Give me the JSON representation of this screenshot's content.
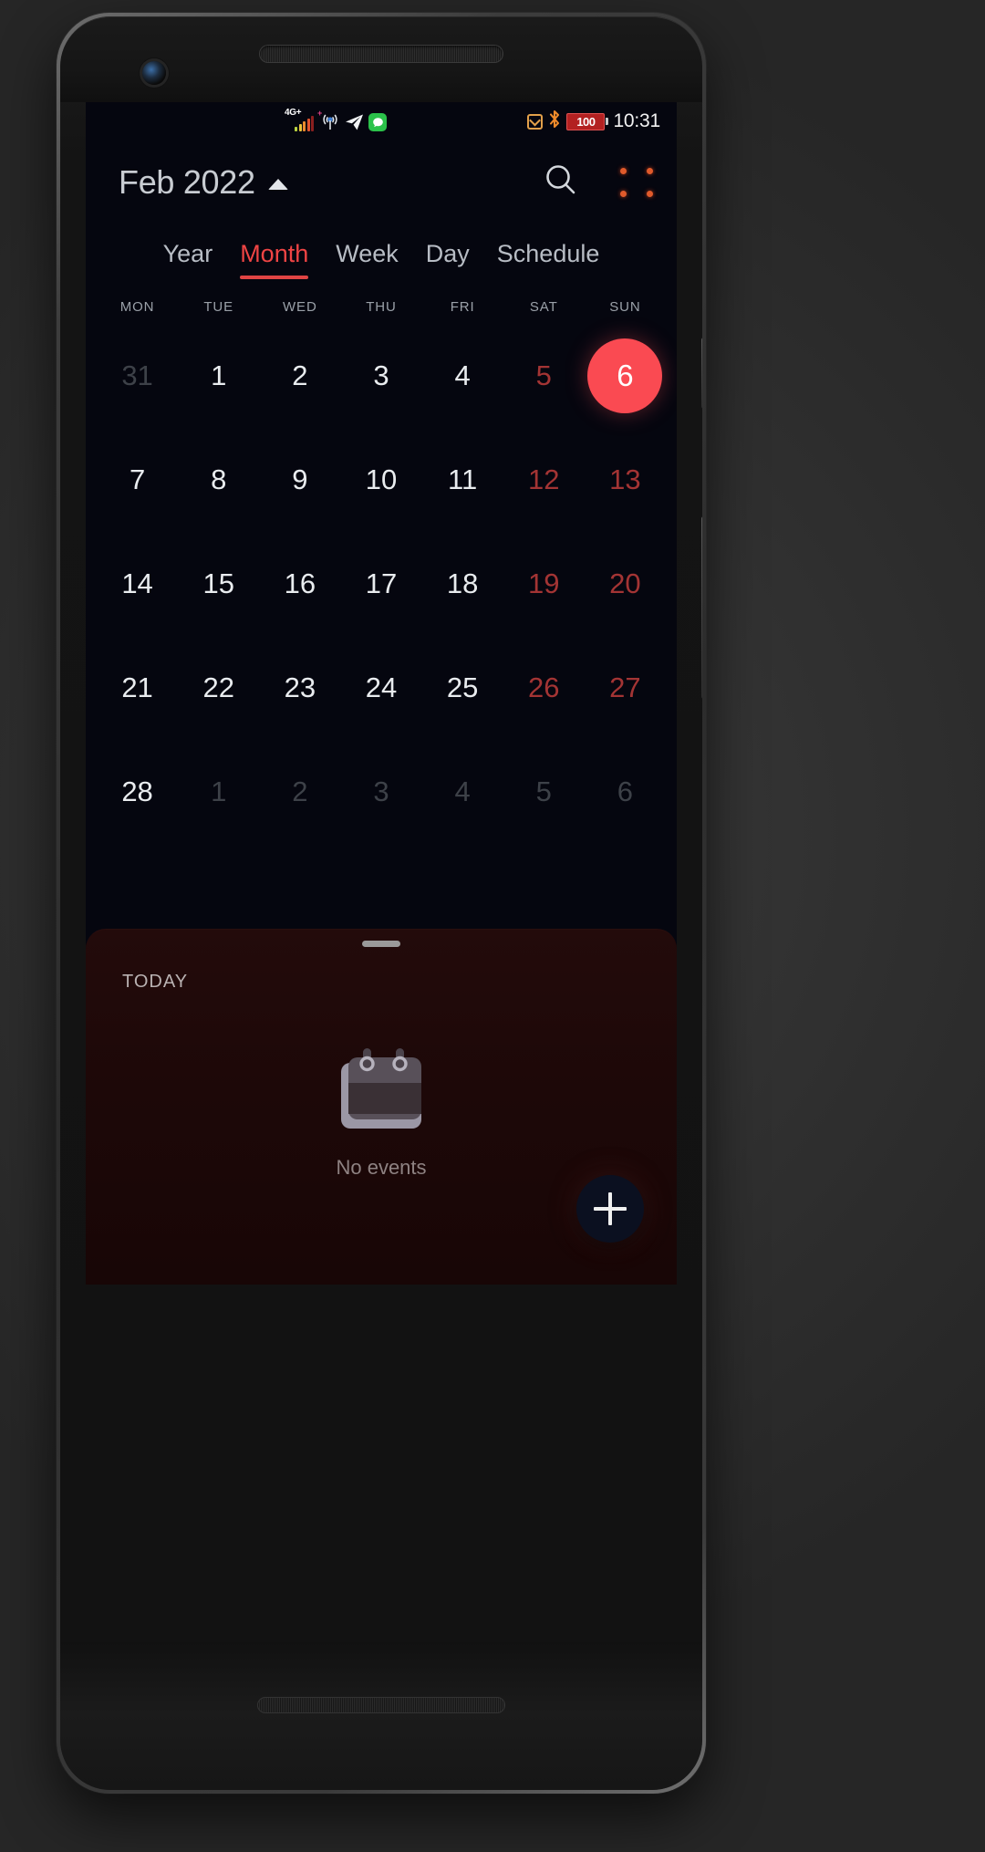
{
  "status_bar": {
    "network_type": "4G+",
    "sim2_badge": "+",
    "icons": [
      "signal-bars-icon",
      "hotspot-icon",
      "telegram-icon",
      "message-icon",
      "dnd-icon",
      "bluetooth-icon"
    ],
    "battery_percent": "100",
    "time": "10:31"
  },
  "header": {
    "title": "Feb 2022",
    "caret": "caret-up-icon",
    "search_icon": "search-icon",
    "menu_icon": "grid-menu-icon"
  },
  "tabs": [
    {
      "label": "Year",
      "active": false
    },
    {
      "label": "Month",
      "active": true
    },
    {
      "label": "Week",
      "active": false
    },
    {
      "label": "Day",
      "active": false
    },
    {
      "label": "Schedule",
      "active": false
    }
  ],
  "weekdays": [
    "MON",
    "TUE",
    "WED",
    "THU",
    "FRI",
    "SAT",
    "SUN"
  ],
  "calendar": {
    "month_label": "Feb 2022",
    "rows": [
      [
        {
          "d": "31",
          "state": "muted"
        },
        {
          "d": "1",
          "state": "normal"
        },
        {
          "d": "2",
          "state": "normal"
        },
        {
          "d": "3",
          "state": "normal"
        },
        {
          "d": "4",
          "state": "normal"
        },
        {
          "d": "5",
          "state": "weekend"
        },
        {
          "d": "6",
          "state": "today"
        }
      ],
      [
        {
          "d": "7",
          "state": "normal"
        },
        {
          "d": "8",
          "state": "normal"
        },
        {
          "d": "9",
          "state": "normal"
        },
        {
          "d": "10",
          "state": "normal"
        },
        {
          "d": "11",
          "state": "normal"
        },
        {
          "d": "12",
          "state": "weekend"
        },
        {
          "d": "13",
          "state": "weekend"
        }
      ],
      [
        {
          "d": "14",
          "state": "normal"
        },
        {
          "d": "15",
          "state": "normal"
        },
        {
          "d": "16",
          "state": "normal"
        },
        {
          "d": "17",
          "state": "normal"
        },
        {
          "d": "18",
          "state": "normal"
        },
        {
          "d": "19",
          "state": "weekend"
        },
        {
          "d": "20",
          "state": "weekend"
        }
      ],
      [
        {
          "d": "21",
          "state": "normal"
        },
        {
          "d": "22",
          "state": "normal"
        },
        {
          "d": "23",
          "state": "normal"
        },
        {
          "d": "24",
          "state": "normal"
        },
        {
          "d": "25",
          "state": "normal"
        },
        {
          "d": "26",
          "state": "weekend"
        },
        {
          "d": "27",
          "state": "weekend"
        }
      ],
      [
        {
          "d": "28",
          "state": "normal"
        },
        {
          "d": "1",
          "state": "muted"
        },
        {
          "d": "2",
          "state": "muted"
        },
        {
          "d": "3",
          "state": "muted"
        },
        {
          "d": "4",
          "state": "muted"
        },
        {
          "d": "5",
          "state": "muted"
        },
        {
          "d": "6",
          "state": "muted"
        }
      ]
    ]
  },
  "sheet": {
    "section_label": "TODAY",
    "empty_icon": "calendar-icon",
    "empty_text": "No events",
    "fab_icon": "plus-icon"
  },
  "colors": {
    "accent": "#fa4a52",
    "tab_active": "#ef4444",
    "weekend": "#a33434",
    "screen_bg": "#05060f",
    "sheet_bg": "#1d0808",
    "menu_dot": "#e05a2b",
    "battery": "#b32121"
  }
}
